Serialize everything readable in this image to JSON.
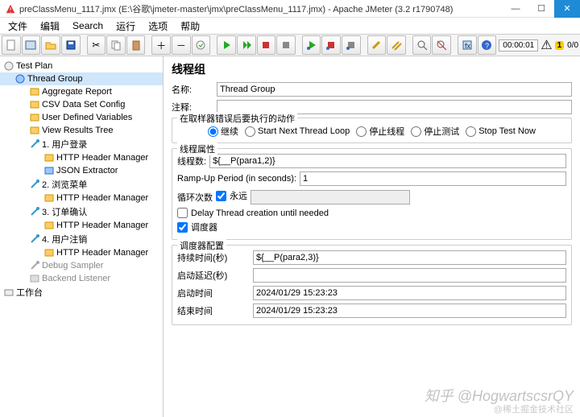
{
  "window": {
    "title": "preClassMenu_1117.jmx (E:\\谷歌\\jmeter-master\\jmx\\preClassMenu_1117.jmx) - Apache JMeter (3.2 r1790748)"
  },
  "menu": {
    "file": "文件",
    "edit": "编辑",
    "search": "Search",
    "run": "运行",
    "options": "选项",
    "help": "帮助"
  },
  "toolbar": {
    "timer": "00:00:01",
    "warn": "1",
    "err": "0"
  },
  "tree": {
    "testplan": "Test Plan",
    "tg": "Thread Group",
    "agg": "Aggregate Report",
    "csv": "CSV Data Set Config",
    "udv": "User Defined Variables",
    "vrt": "View Results Tree",
    "n1": "1. 用户登录",
    "hhm": "HTTP Header Manager",
    "json": "JSON Extractor",
    "n2": "2. 浏览菜单",
    "n3": "3. 订单确认",
    "n4": "4. 用户注销",
    "dbg": "Debug Sampler",
    "bk": "Backend Listener",
    "workbench": "工作台"
  },
  "panel": {
    "title": "线程组",
    "name_lbl": "名称:",
    "name_val": "Thread Group",
    "comments_lbl": "注释:",
    "error_legend": "在取样器错误后要执行的动作",
    "r_continue": "继续",
    "r_next": "Start Next Thread Loop",
    "r_stop_thread": "停止线程",
    "r_stop_test": "停止测试",
    "r_stop_now": "Stop Test Now",
    "props_legend": "线程属性",
    "threads_lbl": "线程数:",
    "threads_val": "${__P(para1,2)}",
    "ramp_lbl": "Ramp-Up Period (in seconds):",
    "ramp_val": "1",
    "loop_lbl": "循环次数",
    "forever": "永远",
    "delay_chk": "Delay Thread creation until needed",
    "sched_chk": "调度器",
    "sched_legend": "调度器配置",
    "dur_lbl": "持续时间(秒)",
    "dur_val": "${__P(para2,3)}",
    "startup_lbl": "启动延迟(秒)",
    "startup_val": "",
    "starttime_lbl": "启动时间",
    "starttime_val": "2024/01/29 15:23:23",
    "endtime_lbl": "结束时间",
    "endtime_val": "2024/01/29 15:23:23"
  },
  "watermark": "知乎 @HogwartscsrQY",
  "watermark2": "@稀土掘金技术社区"
}
